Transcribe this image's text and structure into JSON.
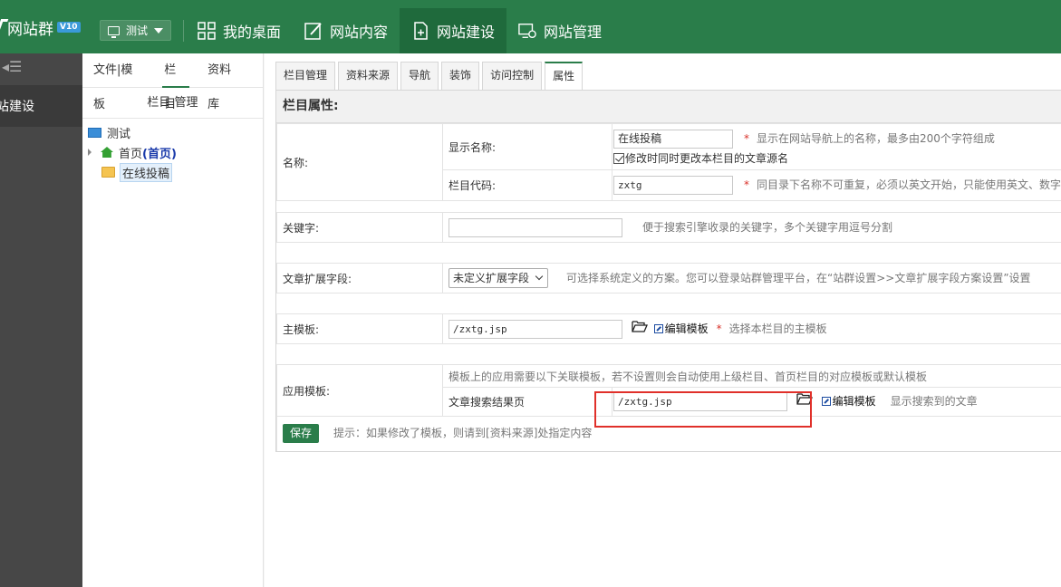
{
  "app": {
    "logo_text": "网站群",
    "version": "V10",
    "site_selector": "测试",
    "nav": [
      {
        "label": "我的桌面",
        "icon": "grid-icon"
      },
      {
        "label": "网站内容",
        "icon": "edit-icon"
      },
      {
        "label": "网站建设",
        "icon": "add-page-icon"
      },
      {
        "label": "网站管理",
        "icon": "monitor-settings-icon"
      }
    ],
    "active_nav": "网站建设"
  },
  "sidebar": {
    "toggle": "◂☰",
    "item": "站建设"
  },
  "tree_panel": {
    "tabs": [
      "文件|模板",
      "栏目",
      "资料库"
    ],
    "active_tab": "栏目",
    "heading": "栏目 管理",
    "root": "测试",
    "nodes": [
      {
        "label": "首页",
        "extra": "(首页)"
      },
      {
        "label": "在线投稿"
      }
    ]
  },
  "content": {
    "tabs": [
      "栏目管理",
      "资料来源",
      "导航",
      "装饰",
      "访问控制",
      "属性"
    ],
    "active_tab": "属性",
    "form_title": "栏目属性:",
    "name_label": "名称:",
    "display_name_label": "显示名称:",
    "display_name_value": "在线投稿",
    "display_name_hint": "显示在网站导航上的名称，最多由200个字符组成",
    "sync_checkbox_label": "修改时同时更改本栏目的文章源名",
    "code_label": "栏目代码:",
    "code_value": "zxtg",
    "code_hint": "同目录下名称不可重复，必须以英文开始，只能使用英文、数字",
    "keywords_label": "关键字:",
    "keywords_value": "",
    "keywords_hint": "便于搜索引擎收录的关键字，多个关键字用逗号分割",
    "ext_field_label": "文章扩展字段:",
    "ext_field_value": "未定义扩展字段",
    "ext_field_hint": "可选择系统定义的方案。您可以登录站群管理平台，在“站群设置>>文章扩展字段方案设置”设置",
    "main_tpl_label": "主模板:",
    "main_tpl_value": "/zxtg.jsp",
    "edit_tpl_label": "编辑模板",
    "main_tpl_hint": "选择本栏目的主模板",
    "app_tpl_label": "应用模板:",
    "app_tpl_note": "模板上的应用需要以下关联模板，若不设置则会自动使用上级栏目、首页栏目的对应模板或默认模板",
    "search_result_label": "文章搜索结果页",
    "search_result_value": "/zxtg.jsp",
    "search_result_hint": "显示搜索到的文章",
    "save_label": "保存",
    "save_hint": "提示：如果修改了模板，则请到[资料来源]处指定内容"
  },
  "colors": {
    "brand_green": "#2a7d4a",
    "highlight_box": "#e0302a"
  }
}
